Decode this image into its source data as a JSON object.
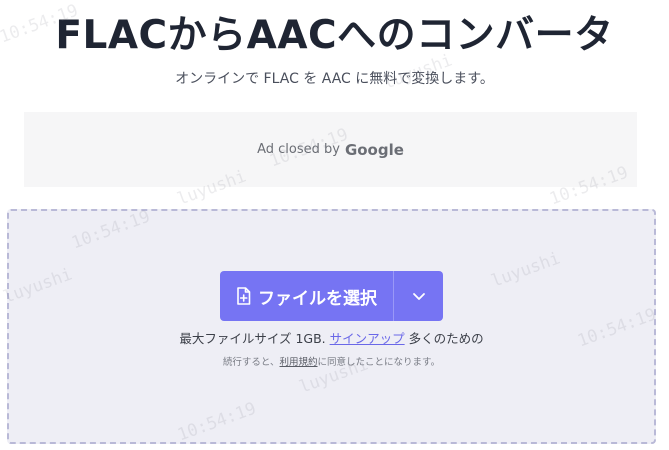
{
  "header": {
    "title": "FLACからAACへのコンバータ",
    "subtitle": "オンラインで FLAC を AAC に無料で変換します。"
  },
  "ad": {
    "text": "Ad closed by",
    "brand": "Google"
  },
  "upload": {
    "button_label": "ファイルを選択",
    "max_size_prefix": "最大ファイルサイズ 1GB.",
    "signup_link": "サインアップ",
    "max_size_suffix": "多くのための",
    "terms_prefix": "続行すると、",
    "terms_link": "利用規約",
    "terms_suffix": "に同意したことになります。"
  },
  "watermark": {
    "text_a": "luyushi",
    "text_b": "10:54:19"
  },
  "colors": {
    "button": "#7674f3",
    "drop_zone_bg": "#eeeef5",
    "link": "#6a68e8"
  }
}
